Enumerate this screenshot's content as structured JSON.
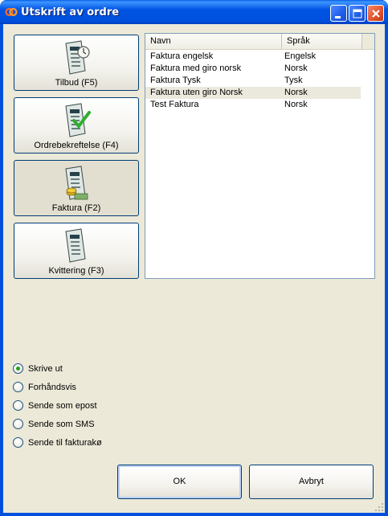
{
  "window": {
    "title": "Utskrift av ordre",
    "controls": [
      "minimize-icon",
      "maximize-icon",
      "close-icon"
    ]
  },
  "report_buttons": [
    {
      "label": "Tilbud (F5)",
      "icon": "quote-document-clock-icon",
      "pressed": false
    },
    {
      "label": "Ordrebekreftelse (F4)",
      "icon": "order-confirmation-checkmark-icon",
      "pressed": false
    },
    {
      "label": "Faktura (F2)",
      "icon": "invoice-coins-icon",
      "pressed": true
    },
    {
      "label": "Kvittering (F3)",
      "icon": "receipt-document-icon",
      "pressed": false
    }
  ],
  "template_list": {
    "columns": [
      "Navn",
      "Språk"
    ],
    "rows": [
      {
        "name": "Faktura engelsk",
        "language": "Engelsk",
        "selected": false
      },
      {
        "name": "Faktura med giro norsk",
        "language": "Norsk",
        "selected": false
      },
      {
        "name": "Faktura Tysk",
        "language": "Tysk",
        "selected": false
      },
      {
        "name": "Faktura uten giro Norsk",
        "language": "Norsk",
        "selected": true
      },
      {
        "name": "Test Faktura",
        "language": "Norsk",
        "selected": false
      }
    ]
  },
  "output_options": {
    "selected": "Skrive ut",
    "items": [
      "Skrive ut",
      "Forhåndsvis",
      "Sende som epost",
      "Sende som SMS",
      "Sende til fakturakø"
    ]
  },
  "dialog_buttons": {
    "ok": "OK",
    "cancel": "Avbryt"
  },
  "colors": {
    "titlebar": "#0054e3",
    "client": "#ece9d8",
    "selected_row": "#ebe9dd",
    "radio_dot": "#21a121"
  }
}
